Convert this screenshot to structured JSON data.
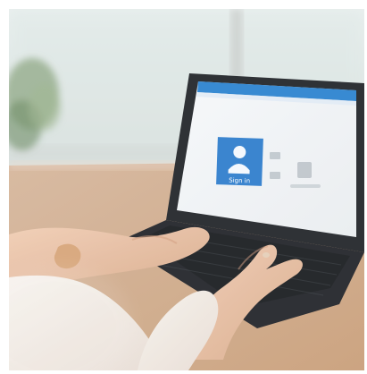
{
  "scene": {
    "description": "",
    "screen": {
      "primary_tile_label": "Sign in",
      "accent": "#2f7ecd",
      "header_color": "#2c83d0"
    },
    "colors": {
      "window_light": "#eef3f1",
      "desk": "#cfae91",
      "laptop": "#26282c",
      "skin": "#e7c2a7",
      "sleeve": "#f2ece6"
    }
  }
}
